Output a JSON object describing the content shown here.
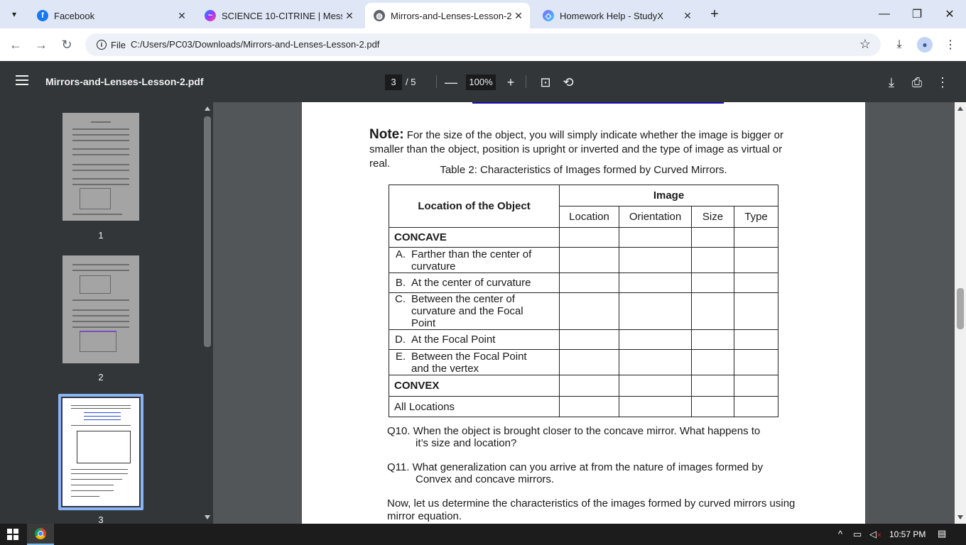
{
  "browser": {
    "tabs": [
      {
        "label": "Facebook",
        "icon": "facebook-icon",
        "color": "#1877f2"
      },
      {
        "label": "SCIENCE 10-CITRINE | Messeng",
        "icon": "messenger-icon",
        "color": "#a033ff"
      },
      {
        "label": "Mirrors-and-Lenses-Lesson-2.p",
        "icon": "globe-icon",
        "color": "#5f6368"
      },
      {
        "label": "Homework Help - StudyX",
        "icon": "studyx-icon",
        "color": "#7b6cf6"
      }
    ],
    "file_chip": "File",
    "url": "C:/Users/PC03/Downloads/Mirrors-and-Lenses-Lesson-2.pdf"
  },
  "pdf_toolbar": {
    "title": "Mirrors-and-Lenses-Lesson-2.pdf",
    "current_page": "3",
    "page_sep": "/",
    "total_pages": "5",
    "zoom": "100%"
  },
  "thumbnails": [
    {
      "number": "1"
    },
    {
      "number": "2"
    },
    {
      "number": "3"
    }
  ],
  "document": {
    "note_label": "Note:",
    "note_text": " For the size of the object, you will simply indicate whether the image is bigger or smaller than the object, position is upright or inverted and the type of image as virtual or real.",
    "table_caption": "Table 2: Characteristics of Images formed by Curved Mirrors.",
    "table": {
      "col_object": "Location of the Object",
      "col_image": "Image",
      "sub_cols": [
        "Location",
        "Orientation",
        "Size",
        "Type"
      ],
      "section_concave": "CONCAVE",
      "concave_rows": [
        {
          "letter": "A.",
          "text": "Farther than the center of curvature"
        },
        {
          "letter": "B.",
          "text": "At the center of curvature"
        },
        {
          "letter": "C.",
          "text": "Between the center of curvature and the Focal Point"
        },
        {
          "letter": "D.",
          "text": "At the Focal Point"
        },
        {
          "letter": "E.",
          "text": "Between the Focal Point and the vertex"
        }
      ],
      "section_convex": "CONVEX",
      "convex_row": "All Locations"
    },
    "q10_line1": "Q10. When the object is brought closer to the concave mirror. What happens to",
    "q10_line2": "it’s size and location?",
    "q11_line1": "Q11. What generalization can you arrive at from the nature of images formed by",
    "q11_line2": "Convex and concave mirrors.",
    "closing": "Now, let us determine the characteristics of the images formed by curved mirrors using mirror equation."
  },
  "taskbar": {
    "time": "10:57 PM"
  }
}
